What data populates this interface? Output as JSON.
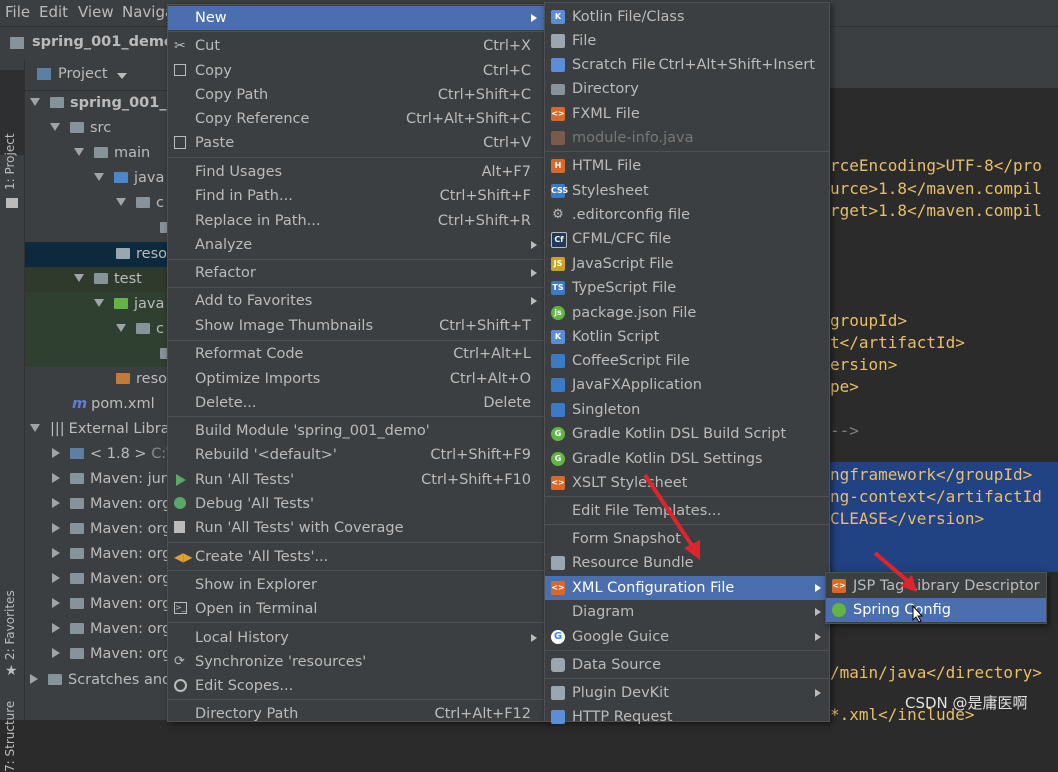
{
  "menubar": {
    "items": [
      "File",
      "Edit",
      "View",
      "Naviga"
    ]
  },
  "navbar": {
    "breadcrumb": "spring_001_demo"
  },
  "sidebar": {
    "project_tab": "1: Project",
    "favorites_tab": "2: Favorites",
    "structure_tab": "7: Structure"
  },
  "project_panel": {
    "header": "Project",
    "tree": [
      "spring_001_de",
      "src",
      "main",
      "java",
      "c",
      "reso",
      "test",
      "java",
      "c",
      "reso",
      "pom.xml",
      "External Librar",
      "< 1.8 >",
      "C:\\",
      "Maven: jun",
      "Maven: org",
      "Maven: org",
      "Maven: org",
      "Maven: org",
      "Maven: org",
      "Maven: org",
      "Maven: org",
      "Scratches and"
    ]
  },
  "editor_lines": [
    "rceEncoding>UTF-8</pro",
    "urce>1.8</maven.compil",
    "rget>1.8</maven.compil",
    "groupId>",
    "t</artifactId>",
    "ersion>",
    "pe>",
    "-->",
    "ngframework</groupId>",
    "ng-context</artifactId",
    "CLEASE</version>",
    "/main/java</directory>",
    "*.xml</include>"
  ],
  "context_menu": {
    "items": [
      {
        "label": "New",
        "shortcut": ""
      },
      {
        "label": "Cut",
        "shortcut": "Ctrl+X"
      },
      {
        "label": "Copy",
        "shortcut": "Ctrl+C"
      },
      {
        "label": "Copy Path",
        "shortcut": "Ctrl+Shift+C"
      },
      {
        "label": "Copy Reference",
        "shortcut": "Ctrl+Alt+Shift+C"
      },
      {
        "label": "Paste",
        "shortcut": "Ctrl+V"
      },
      {
        "label": "Find Usages",
        "shortcut": "Alt+F7"
      },
      {
        "label": "Find in Path...",
        "shortcut": "Ctrl+Shift+F"
      },
      {
        "label": "Replace in Path...",
        "shortcut": "Ctrl+Shift+R"
      },
      {
        "label": "Analyze",
        "shortcut": ""
      },
      {
        "label": "Refactor",
        "shortcut": ""
      },
      {
        "label": "Add to Favorites",
        "shortcut": ""
      },
      {
        "label": "Show Image Thumbnails",
        "shortcut": "Ctrl+Shift+T"
      },
      {
        "label": "Reformat Code",
        "shortcut": "Ctrl+Alt+L"
      },
      {
        "label": "Optimize Imports",
        "shortcut": "Ctrl+Alt+O"
      },
      {
        "label": "Delete...",
        "shortcut": "Delete"
      },
      {
        "label": "Build Module 'spring_001_demo'",
        "shortcut": ""
      },
      {
        "label": "Rebuild '<default>'",
        "shortcut": "Ctrl+Shift+F9"
      },
      {
        "label": "Run 'All Tests'",
        "shortcut": "Ctrl+Shift+F10"
      },
      {
        "label": "Debug 'All Tests'",
        "shortcut": ""
      },
      {
        "label": "Run 'All Tests' with Coverage",
        "shortcut": ""
      },
      {
        "label": "Create 'All Tests'...",
        "shortcut": ""
      },
      {
        "label": "Show in Explorer",
        "shortcut": ""
      },
      {
        "label": "Open in Terminal",
        "shortcut": ""
      },
      {
        "label": "Local History",
        "shortcut": ""
      },
      {
        "label": "Synchronize 'resources'",
        "shortcut": ""
      },
      {
        "label": "Edit Scopes...",
        "shortcut": ""
      },
      {
        "label": "Directory Path",
        "shortcut": "Ctrl+Alt+F12"
      }
    ]
  },
  "new_submenu": {
    "items": [
      {
        "label": "Kotlin File/Class",
        "shortcut": ""
      },
      {
        "label": "File",
        "shortcut": ""
      },
      {
        "label": "Scratch File",
        "shortcut": "Ctrl+Alt+Shift+Insert"
      },
      {
        "label": "Directory",
        "shortcut": ""
      },
      {
        "label": "FXML File",
        "shortcut": ""
      },
      {
        "label": "module-info.java",
        "shortcut": ""
      },
      {
        "label": "HTML File",
        "shortcut": ""
      },
      {
        "label": "Stylesheet",
        "shortcut": ""
      },
      {
        "label": ".editorconfig file",
        "shortcut": ""
      },
      {
        "label": "CFML/CFC file",
        "shortcut": ""
      },
      {
        "label": "JavaScript File",
        "shortcut": ""
      },
      {
        "label": "TypeScript File",
        "shortcut": ""
      },
      {
        "label": "package.json File",
        "shortcut": ""
      },
      {
        "label": "Kotlin Script",
        "shortcut": ""
      },
      {
        "label": "CoffeeScript File",
        "shortcut": ""
      },
      {
        "label": "JavaFXApplication",
        "shortcut": ""
      },
      {
        "label": "Singleton",
        "shortcut": ""
      },
      {
        "label": "Gradle Kotlin DSL Build Script",
        "shortcut": ""
      },
      {
        "label": "Gradle Kotlin DSL Settings",
        "shortcut": ""
      },
      {
        "label": "XSLT Stylesheet",
        "shortcut": ""
      },
      {
        "label": "Edit File Templates...",
        "shortcut": ""
      },
      {
        "label": "Form Snapshot",
        "shortcut": ""
      },
      {
        "label": "Resource Bundle",
        "shortcut": ""
      },
      {
        "label": "XML Configuration File",
        "shortcut": ""
      },
      {
        "label": "Diagram",
        "shortcut": ""
      },
      {
        "label": "Google Guice",
        "shortcut": ""
      },
      {
        "label": "Data Source",
        "shortcut": ""
      },
      {
        "label": "Plugin DevKit",
        "shortcut": ""
      },
      {
        "label": "HTTP Request",
        "shortcut": ""
      }
    ]
  },
  "xml_submenu": {
    "items": [
      {
        "label": "JSP Tag Library Descriptor"
      },
      {
        "label": "Spring Config"
      }
    ]
  },
  "watermark": "CSDN @是庸医啊",
  "colors": {
    "selection": "#4b6eaf",
    "menu_bg": "#3c3f41",
    "annotation_arrow": "#e0242c"
  }
}
